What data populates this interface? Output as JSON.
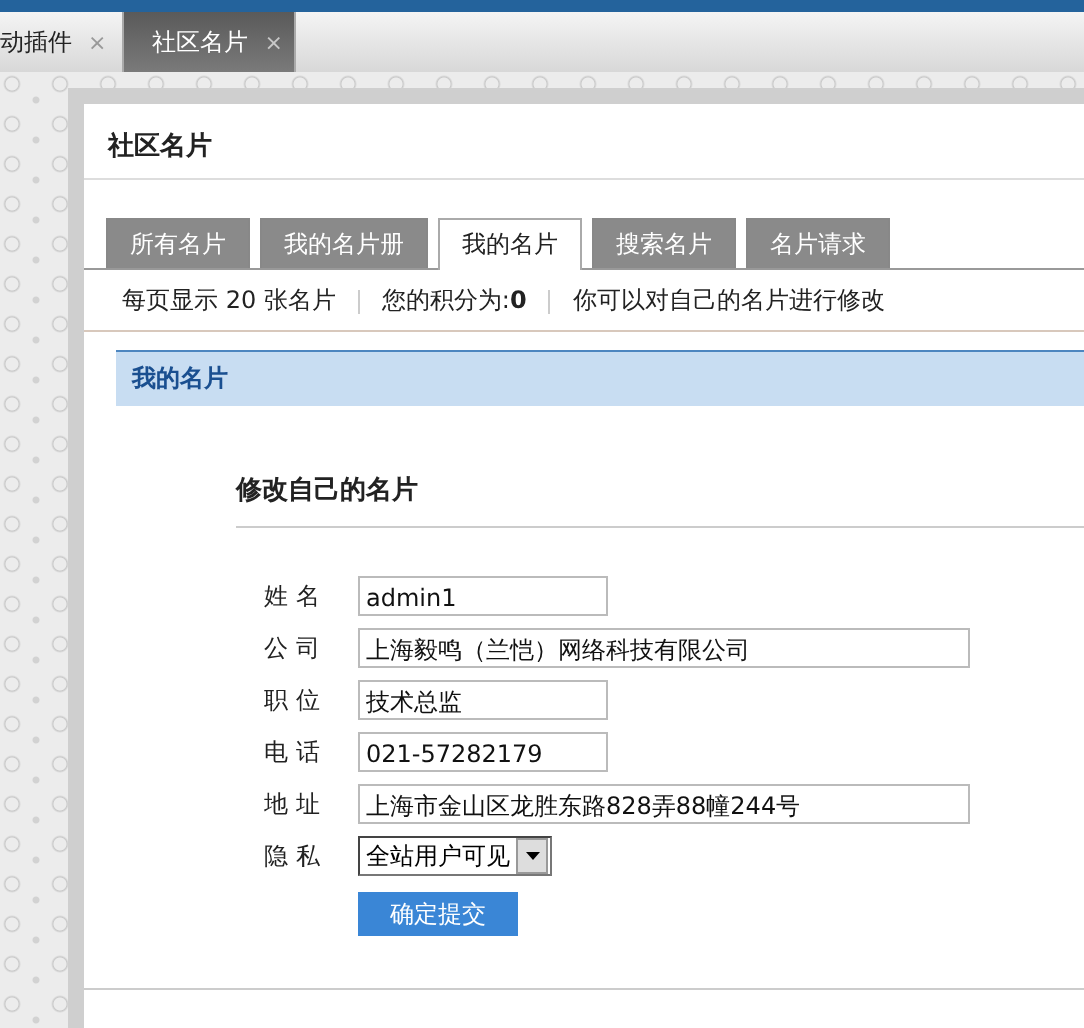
{
  "app_tabs": [
    {
      "label": "动插件",
      "close": "×",
      "selected": false
    },
    {
      "label": "社区名片",
      "close": "×",
      "selected": true
    }
  ],
  "panel": {
    "title": "社区名片"
  },
  "tabs": [
    {
      "label": "所有名片",
      "selected": false
    },
    {
      "label": "我的名片册",
      "selected": false
    },
    {
      "label": "我的名片",
      "selected": true
    },
    {
      "label": "搜索名片",
      "selected": false
    },
    {
      "label": "名片请求",
      "selected": false
    }
  ],
  "info": [
    "每页显示 20 张名片",
    "您的积分为:**0**",
    "你可以对自己的名片进行修改"
  ],
  "section_header": "我的名片",
  "form": {
    "title": "修改自己的名片",
    "fields": [
      {
        "label": "姓 名",
        "kind": "short",
        "value": "admin1"
      },
      {
        "label": "公 司",
        "kind": "long",
        "value": "上海毅鸣（兰恺）网络科技有限公司"
      },
      {
        "label": "职 位",
        "kind": "short",
        "value": "技术总监"
      },
      {
        "label": "电 话",
        "kind": "short",
        "value": "021-57282179"
      },
      {
        "label": "地 址",
        "kind": "long",
        "value": "上海市金山区龙胜东路828弄88幢244号"
      },
      {
        "label": "隐 私",
        "kind": "select",
        "value": "全站用户可见"
      }
    ],
    "submit": "确定提交"
  }
}
